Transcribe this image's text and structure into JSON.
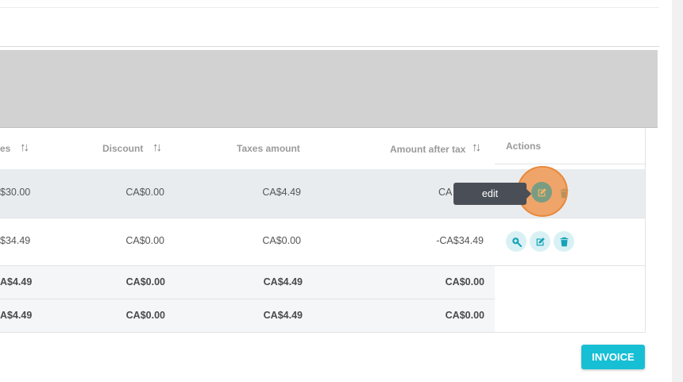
{
  "colors": {
    "accent": "#17bfd4",
    "icon_color": "#17a2b8",
    "tooltip_bg": "#4a4f57",
    "highlight": "#f08c3c",
    "banner": "#d2d2d2"
  },
  "table": {
    "headers": {
      "col_partial": "es",
      "discount": "Discount",
      "taxes_amount": "Taxes amount",
      "amount_after_tax": "Amount after tax",
      "actions": "Actions"
    },
    "rows": [
      {
        "col_partial": "$30.00",
        "discount": "CA$0.00",
        "taxes_amount": "CA$4.49",
        "amount_after_tax": "CA"
      },
      {
        "col_partial": "$34.49",
        "discount": "CA$0.00",
        "taxes_amount": "CA$0.00",
        "amount_after_tax": "-CA$34.49"
      }
    ],
    "totals": [
      {
        "col_partial": "A$4.49",
        "discount": "CA$0.00",
        "taxes_amount": "CA$4.49",
        "amount_after_tax": "CA$0.00"
      },
      {
        "col_partial": "A$4.49",
        "discount": "CA$0.00",
        "taxes_amount": "CA$4.49",
        "amount_after_tax": "CA$0.00"
      }
    ]
  },
  "icons": {
    "view": "magnifier-plus-icon",
    "edit": "edit-icon",
    "delete": "trash-icon",
    "sort": "sort-arrows-icon"
  },
  "tooltip": {
    "text": "edit"
  },
  "invoice_button": {
    "label": "INVOICE"
  }
}
